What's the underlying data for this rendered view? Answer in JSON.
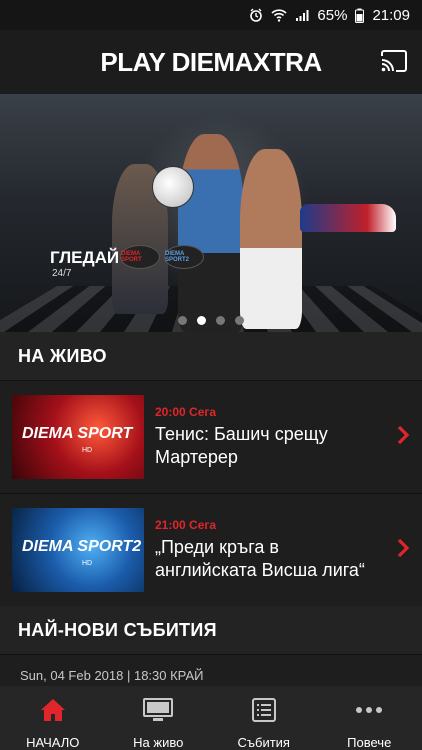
{
  "status_bar": {
    "battery": "65%",
    "time": "21:09"
  },
  "app_bar": {
    "logo_left": "PL",
    "logo_x": "A",
    "logo_y": "Y",
    "logo_rest": " DIEMAXTRA"
  },
  "hero": {
    "watch": "ГЛЕДАЙ",
    "watch_sub": "24/7",
    "channel_1": "DIEMA SPORT",
    "channel_2": "DIEMA SPORT2",
    "pages": 4,
    "active_page": 2
  },
  "live_section": {
    "title": "НА ЖИВО"
  },
  "live_items": [
    {
      "brand": "DIEMA SPORT",
      "hd": "HD",
      "time": "20:00 Сега",
      "title": "Тенис: Башич срещу Мартерер"
    },
    {
      "brand": "DIEMA SPORT2",
      "hd": "HD",
      "time": "21:00 Сега",
      "title": "„Преди кръга в английската Висша лига“"
    }
  ],
  "events_section": {
    "title": "НАЙ-НОВИ СЪБИТИЯ"
  },
  "event_meta": "Sun, 04 Feb 2018 | 18:30  КРАЙ",
  "bottom_nav": {
    "home": "НАЧАЛО",
    "live": "На живо",
    "events": "Събития",
    "more": "Повече"
  },
  "colors": {
    "accent": "#e0262b",
    "background": "#1e1e1e",
    "header": "#232323"
  }
}
